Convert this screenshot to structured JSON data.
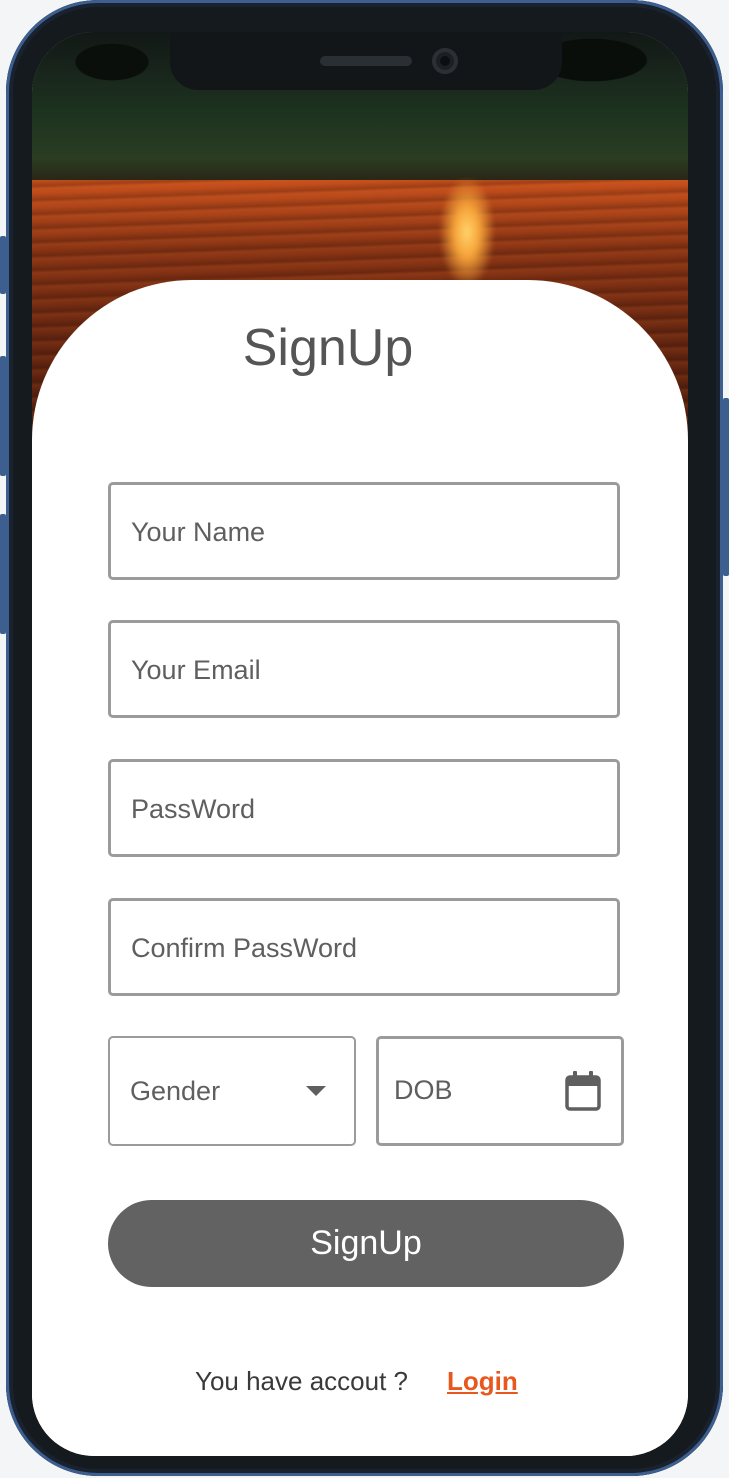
{
  "form": {
    "title": "SignUp",
    "name_placeholder": "Your Name",
    "email_placeholder": "Your Email",
    "password_placeholder": "PassWord",
    "confirm_password_placeholder": "Confirm PassWord",
    "gender_label": "Gender",
    "dob_label": "DOB",
    "submit_label": "SignUp"
  },
  "footer": {
    "prompt": "You have accout ?",
    "login_label": "Login"
  },
  "colors": {
    "button": "#626262",
    "link": "#e8571e",
    "field_border": "#9b9b9b"
  },
  "icons": {
    "dropdown": "caret-down-icon",
    "date": "calendar-icon"
  }
}
